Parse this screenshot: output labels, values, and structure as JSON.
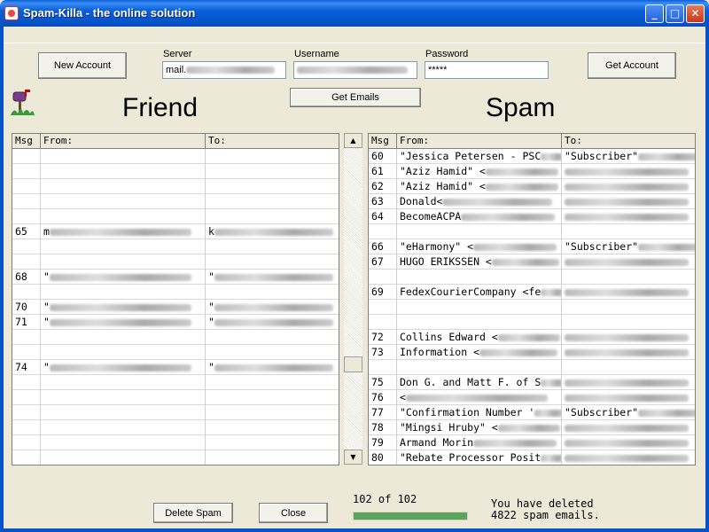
{
  "window": {
    "title": "Spam-Killa - the online solution",
    "buttons": {
      "minimize": "_",
      "maximize": "□",
      "close": "✕"
    }
  },
  "toolbar": {
    "new_account_label": "New Account",
    "get_account_label": "Get Account",
    "get_emails_label": "Get Emails",
    "server_label": "Server",
    "server_value": "mail.",
    "username_label": "Username",
    "username_value": "",
    "password_label": "Password",
    "password_value": "*****"
  },
  "friend": {
    "title": "Friend",
    "columns": [
      "Msg",
      "From:",
      "To:"
    ],
    "rows": [
      {
        "msg": "",
        "from": "",
        "to": ""
      },
      {
        "msg": "",
        "from": "",
        "to": ""
      },
      {
        "msg": "",
        "from": "",
        "to": ""
      },
      {
        "msg": "",
        "from": "",
        "to": ""
      },
      {
        "msg": "",
        "from": "",
        "to": ""
      },
      {
        "msg": "65",
        "from": "m",
        "to": "k"
      },
      {
        "msg": "",
        "from": "",
        "to": ""
      },
      {
        "msg": "",
        "from": "",
        "to": ""
      },
      {
        "msg": "68",
        "from": "\"",
        "to": "\""
      },
      {
        "msg": "",
        "from": "",
        "to": ""
      },
      {
        "msg": "70",
        "from": "\"",
        "to": "\""
      },
      {
        "msg": "71",
        "from": "\"",
        "to": "\""
      },
      {
        "msg": "",
        "from": "",
        "to": ""
      },
      {
        "msg": "",
        "from": "",
        "to": ""
      },
      {
        "msg": "74",
        "from": "\"",
        "to": "\""
      },
      {
        "msg": "",
        "from": "",
        "to": ""
      },
      {
        "msg": "",
        "from": "",
        "to": ""
      },
      {
        "msg": "",
        "from": "",
        "to": ""
      },
      {
        "msg": "",
        "from": "",
        "to": ""
      },
      {
        "msg": "",
        "from": "",
        "to": ""
      },
      {
        "msg": "",
        "from": "",
        "to": ""
      }
    ]
  },
  "spam": {
    "title": "Spam",
    "columns": [
      "Msg",
      "From:",
      "To:"
    ],
    "rows": [
      {
        "msg": "60",
        "from": "\"Jessica Petersen - PSC",
        "to": "\"Subscriber\""
      },
      {
        "msg": "61",
        "from": "\"Aziz Hamid\" <",
        "to": ""
      },
      {
        "msg": "62",
        "from": "\"Aziz Hamid\" <",
        "to": ""
      },
      {
        "msg": "63",
        "from": "Donald<",
        "to": ""
      },
      {
        "msg": "64",
        "from": "BecomeACPA",
        "to": ""
      },
      {
        "msg": "",
        "from": "",
        "to": ""
      },
      {
        "msg": "66",
        "from": "\"eHarmony\" <",
        "to": "\"Subscriber\""
      },
      {
        "msg": "67",
        "from": "HUGO ERIKSSEN <",
        "to": ""
      },
      {
        "msg": "",
        "from": "",
        "to": ""
      },
      {
        "msg": "69",
        "from": "FedexCourierCompany <fe",
        "to": ""
      },
      {
        "msg": "",
        "from": "",
        "to": ""
      },
      {
        "msg": "",
        "from": "",
        "to": ""
      },
      {
        "msg": "72",
        "from": "Collins Edward <",
        "to": ""
      },
      {
        "msg": "73",
        "from": "Information <",
        "to": ""
      },
      {
        "msg": "",
        "from": "",
        "to": ""
      },
      {
        "msg": "75",
        "from": "Don G. and Matt F. of S",
        "to": ""
      },
      {
        "msg": "76",
        "from": "<",
        "to": ""
      },
      {
        "msg": "77",
        "from": "\"Confirmation Number '",
        "to": "\"Subscriber\""
      },
      {
        "msg": "78",
        "from": "\"Mingsi Hruby\" <",
        "to": ""
      },
      {
        "msg": "79",
        "from": "Armand Morin",
        "to": ""
      },
      {
        "msg": "80",
        "from": "\"Rebate Processor Posit",
        "to": ""
      }
    ]
  },
  "footer": {
    "delete_spam_label": "Delete Spam",
    "close_label": "Close",
    "progress_text": "102 of 102",
    "progress_fraction": 1.0,
    "deleted_line1": "You have deleted",
    "deleted_line2": "4822 spam emails."
  },
  "colors": {
    "progress": "#5ca45e",
    "titlebar": "#0a5fd7"
  }
}
